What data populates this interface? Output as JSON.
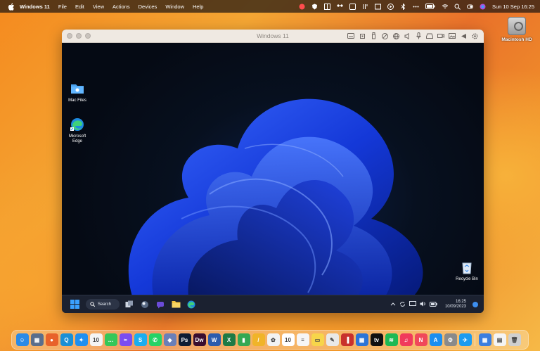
{
  "menubar": {
    "app_name": "Windows 11",
    "items": [
      "File",
      "Edit",
      "View",
      "Actions",
      "Devices",
      "Window",
      "Help"
    ],
    "clock": "Sun 10 Sep  16:25",
    "status_icons": [
      "parallels-icon",
      "shield-icon",
      "grid-icon",
      "dropbox-icon",
      "control-strip-icon",
      "fork-icon",
      "screen-record-icon",
      "play-icon",
      "bluetooth-icon",
      "dots-icon",
      "battery-icon",
      "wifi-icon",
      "search-icon",
      "user-switch-icon",
      "siri-icon"
    ]
  },
  "desktop": {
    "hd_label": "Macintosh HD"
  },
  "vm_window": {
    "title": "Windows 11",
    "toolbar_icons": [
      "keyboard-icon",
      "cpu-icon",
      "usb-icon",
      "cd-icon",
      "network-icon",
      "sound-icon",
      "microphone-icon",
      "drive-icon",
      "camera-icon",
      "picture-icon",
      "share-icon",
      "gear-icon"
    ]
  },
  "windows": {
    "desktop_icons": [
      {
        "label": "Mac Files"
      },
      {
        "label": "Microsoft\nEdge"
      },
      {
        "label": "Recycle Bin"
      }
    ],
    "taskbar": {
      "search_label": "Search",
      "apps": [
        "start-icon",
        "task-view-icon",
        "widgets-icon",
        "chat-icon",
        "file-explorer-icon",
        "edge-icon"
      ],
      "time": "16:25",
      "date": "10/09/2023"
    }
  },
  "dock": {
    "apps": [
      {
        "name": "finder-icon",
        "color": "#2b8ae6",
        "glyph": "☺"
      },
      {
        "name": "launchpad-icon",
        "color": "#5a6e8c",
        "glyph": "▦"
      },
      {
        "name": "firefox-icon",
        "color": "#e8622a",
        "glyph": "●"
      },
      {
        "name": "quick-icon",
        "color": "#1a8fd6",
        "glyph": "Q"
      },
      {
        "name": "safari-icon",
        "color": "#1f8ff0",
        "glyph": "✦"
      },
      {
        "name": "calendar-icon",
        "color": "#f4f4f4",
        "glyph": "10"
      },
      {
        "name": "messages-icon",
        "color": "#34c759",
        "glyph": "…"
      },
      {
        "name": "messenger-icon",
        "color": "#7a4df0",
        "glyph": "≈"
      },
      {
        "name": "skype-icon",
        "color": "#1badef",
        "glyph": "S"
      },
      {
        "name": "whatsapp-icon",
        "color": "#25d366",
        "glyph": "✆"
      },
      {
        "name": "virtualbox-icon",
        "color": "#6a7fb8",
        "glyph": "◆"
      },
      {
        "name": "photoshop-icon",
        "color": "#0d1c33",
        "glyph": "Ps"
      },
      {
        "name": "dreamweaver-icon",
        "color": "#3a0e2f",
        "glyph": "Dw"
      },
      {
        "name": "word-icon",
        "color": "#2b5cad",
        "glyph": "W"
      },
      {
        "name": "excel-icon",
        "color": "#1e7a45",
        "glyph": "X"
      },
      {
        "name": "numbers-icon",
        "color": "#34a853",
        "glyph": "▮"
      },
      {
        "name": "pencil-icon",
        "color": "#f0b429",
        "glyph": "/"
      },
      {
        "name": "photos-icon",
        "color": "#f2f2f2",
        "glyph": "✿"
      },
      {
        "name": "calendar-app-icon",
        "color": "#ffffff",
        "glyph": "10"
      },
      {
        "name": "reminders-icon",
        "color": "#f6f6f6",
        "glyph": "≡"
      },
      {
        "name": "notes-icon",
        "color": "#f7d54a",
        "glyph": "▭"
      },
      {
        "name": "textedit-icon",
        "color": "#e9e9e9",
        "glyph": "✎"
      },
      {
        "name": "parallels-icon",
        "color": "#c8312c",
        "glyph": "▐"
      },
      {
        "name": "windows-icon",
        "color": "#2c74d6",
        "glyph": "▦"
      },
      {
        "name": "apple-tv-icon",
        "color": "#111111",
        "glyph": "tv"
      },
      {
        "name": "spotify-icon",
        "color": "#1db954",
        "glyph": "≋"
      },
      {
        "name": "music-icon",
        "color": "#f03a5c",
        "glyph": "♫"
      },
      {
        "name": "news-icon",
        "color": "#f0485a",
        "glyph": "N"
      },
      {
        "name": "app-store-icon",
        "color": "#1a8ef0",
        "glyph": "A"
      },
      {
        "name": "settings-icon",
        "color": "#8a8a8a",
        "glyph": "⚙"
      },
      {
        "name": "twitter-icon",
        "color": "#1d9bf0",
        "glyph": "✈"
      },
      {
        "name": "windows-app-icon",
        "color": "#3b7ee0",
        "glyph": "▦"
      },
      {
        "name": "document-icon",
        "color": "#f4f4f4",
        "glyph": "▤"
      },
      {
        "name": "trash-icon",
        "color": "#cfcfcf",
        "glyph": "🗑"
      }
    ]
  }
}
